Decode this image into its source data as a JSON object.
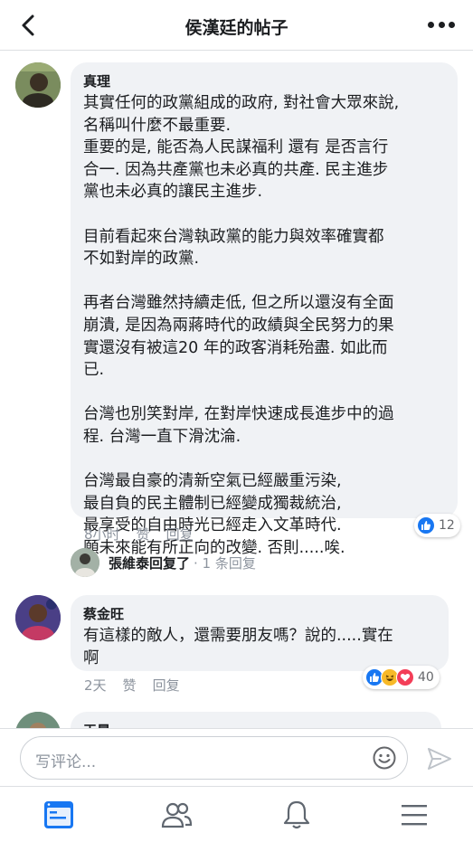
{
  "header": {
    "title": "侯漢廷的帖子",
    "back_icon": "chevron-left-icon",
    "more_icon": "more-horizontal-icon"
  },
  "comments": [
    {
      "author": "真理",
      "text": "其實任何的政黨組成的政府, 對社會大眾來說,\n名稱叫什麼不最重要.\n重要的是, 能否為人民謀福利 還有 是否言行\n合一.  因為共產黨也未必真的共產.  民主進步\n黨也未必真的讓民主進步.\n\n目前看起來台灣執政黨的能力與效率確實都\n不如對岸的政黨.\n\n再者台灣雖然持續走低, 但之所以還沒有全面\n崩潰, 是因為兩蔣時代的政績與全民努力的果\n實還沒有被這20 年的政客消耗殆盡.  如此而\n已.\n\n台灣也別笑對岸, 在對岸快速成長進步中的過\n程.  台灣一直下滑沈淪.\n\n台灣最自豪的清新空氣已經嚴重污染,\n最自負的民主體制已經變成獨裁統治,\n最享受的自由時光已經走入文革時代.\n願未來能有所正向的改變.  否則.....唉.",
      "time": "8小时",
      "like_label": "赞",
      "reply_label": "回复",
      "reaction_count": "12",
      "reactions": [
        "like"
      ],
      "reply_summary": {
        "text": "張維泰回复了",
        "count": "· 1 条回复"
      }
    },
    {
      "author": "蔡金旺",
      "text": "有這樣的敵人，還需要朋友嗎？說的.....實在\n啊",
      "time": "2天",
      "like_label": "赞",
      "reply_label": "回复",
      "reaction_count": "40",
      "reactions": [
        "like",
        "haha",
        "love"
      ]
    },
    {
      "author": "王晨"
    }
  ],
  "composer": {
    "placeholder": "写评论...",
    "emoji_icon": "emoji-icon",
    "send_icon": "send-icon"
  },
  "tabbar": {
    "items": [
      "news-feed-icon",
      "friends-icon",
      "notifications-icon",
      "menu-icon"
    ],
    "active": "news-feed-icon",
    "active_color": "#1877f2",
    "inactive_color": "#606770"
  },
  "colors": {
    "like_blue": "#1877f2",
    "love_red": "#f33e58",
    "haha_yellow": "#f7b928",
    "bubble_bg": "#f0f2f5"
  }
}
